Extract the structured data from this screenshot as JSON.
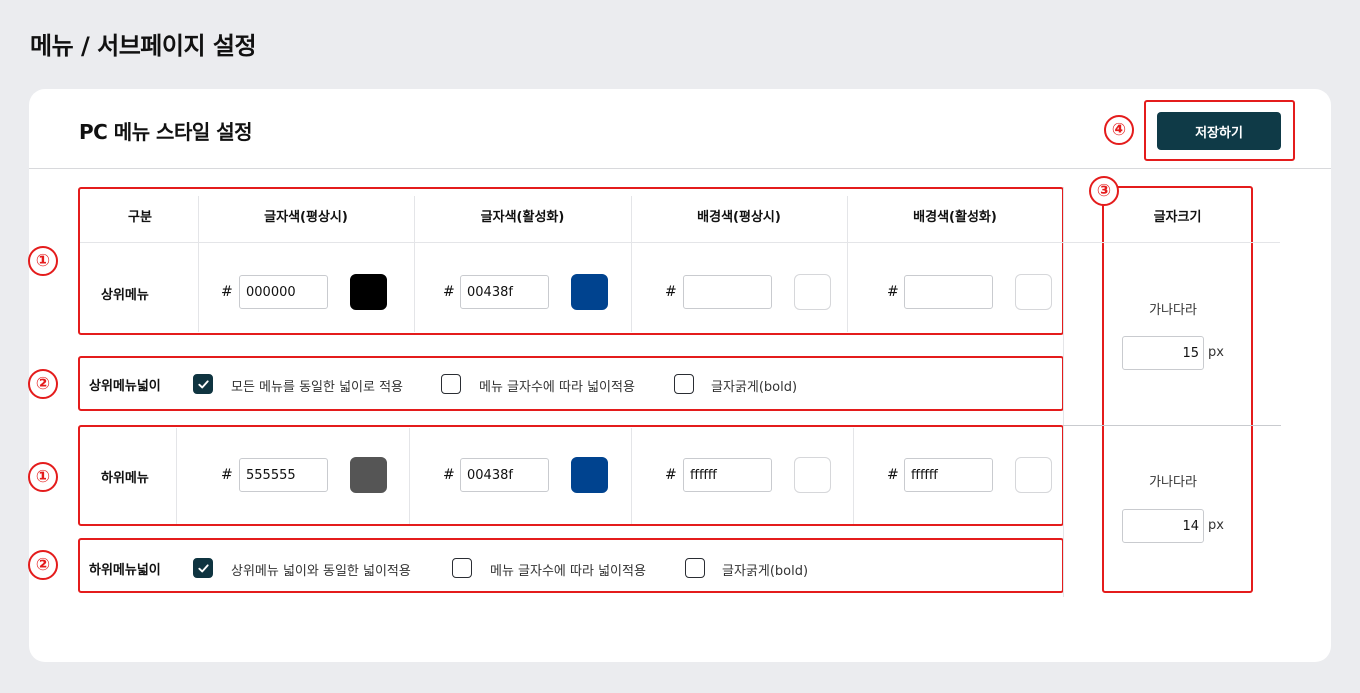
{
  "page_title": "메뉴 / 서브페이지 설정",
  "card_title": "PC 메뉴 스타일 설정",
  "save_label": "저장하기",
  "badges": [
    "①",
    "②",
    "③",
    "④"
  ],
  "table": {
    "headers": [
      "구분",
      "글자색(평상시)",
      "글자색(활성화)",
      "배경색(평상시)",
      "배경색(활성화)"
    ],
    "hash": "#",
    "top": {
      "label": "상위메뉴",
      "values": [
        "000000",
        "00438f",
        "",
        ""
      ],
      "colors": [
        "#000000",
        "#00438f",
        "#ffffff",
        "#ffffff"
      ]
    },
    "sub": {
      "label": "하위메뉴",
      "values": [
        "555555",
        "00438f",
        "ffffff",
        "ffffff"
      ],
      "colors": [
        "#555555",
        "#00438f",
        "#ffffff",
        "#ffffff"
      ]
    }
  },
  "top_width": {
    "label": "상위메뉴넓이",
    "options": [
      {
        "text": "모든 메뉴를 동일한 넓이로 적용",
        "checked": true
      },
      {
        "text": "메뉴 글자수에 따라 넓이적용",
        "checked": false
      },
      {
        "text": "글자굵게(bold)",
        "checked": false
      }
    ]
  },
  "sub_width": {
    "label": "하위메뉴넓이",
    "options": [
      {
        "text": "상위메뉴 넓이와 동일한 넓이적용",
        "checked": true
      },
      {
        "text": "메뉴 글자수에 따라 넓이적용",
        "checked": false
      },
      {
        "text": "글자굵게(bold)",
        "checked": false
      }
    ]
  },
  "font_size": {
    "header": "글자크기",
    "top": {
      "sample": "가나다라",
      "value": "15",
      "unit": "px"
    },
    "sub": {
      "sample": "가나다라",
      "value": "14",
      "unit": "px"
    }
  },
  "colors": {
    "accent": "#0f3a47",
    "highlight": "#e41c1c"
  }
}
